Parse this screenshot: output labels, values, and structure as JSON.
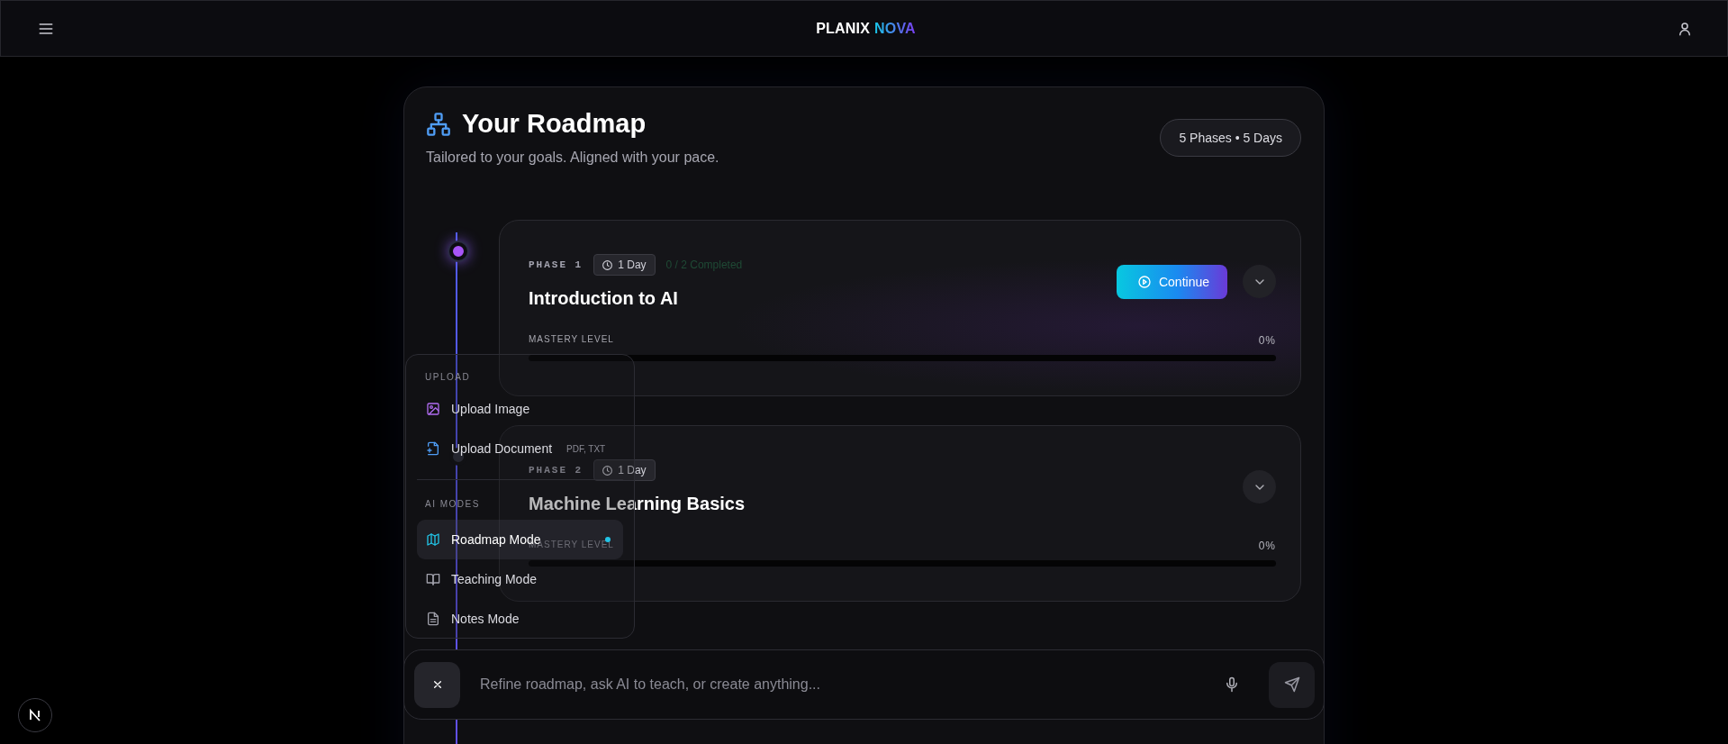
{
  "header": {
    "brand": "PLANIX",
    "brand_accent": "NOVA"
  },
  "roadmap": {
    "title": "Your Roadmap",
    "subtitle": "Tailored to your goals. Aligned with your pace.",
    "summary": "5 Phases • 5 Days",
    "phases": [
      {
        "label": "PHASE 1",
        "duration": "1 Day",
        "progress": "0 / 2 Completed",
        "title": "Introduction to AI",
        "action": "Continue",
        "mastery_label": "MASTERY LEVEL",
        "mastery_reading": "0%",
        "level": 0,
        "active": true
      },
      {
        "label": "PHASE 2",
        "duration": "1 Day",
        "title": "Machine Learning Basics",
        "mastery_label": "MASTERY LEVEL",
        "mastery_reading": "0%",
        "level": 0,
        "active": false
      }
    ]
  },
  "menu": {
    "sections": [
      {
        "heading": "UPLOAD",
        "items": [
          {
            "kind": "image",
            "label": "Upload Image"
          },
          {
            "kind": "document",
            "label": "Upload Document",
            "hint": "PDF, TXT"
          }
        ]
      },
      {
        "heading": "AI MODES",
        "items": [
          {
            "kind": "map",
            "label": "Roadmap Mode",
            "selected": true
          },
          {
            "kind": "book",
            "label": "Teaching Mode",
            "selected": false
          },
          {
            "kind": "notes",
            "label": "Notes Mode",
            "selected": false
          }
        ]
      }
    ]
  },
  "composer": {
    "placeholder": "Refine roadmap, ask AI to teach, or create anything..."
  }
}
